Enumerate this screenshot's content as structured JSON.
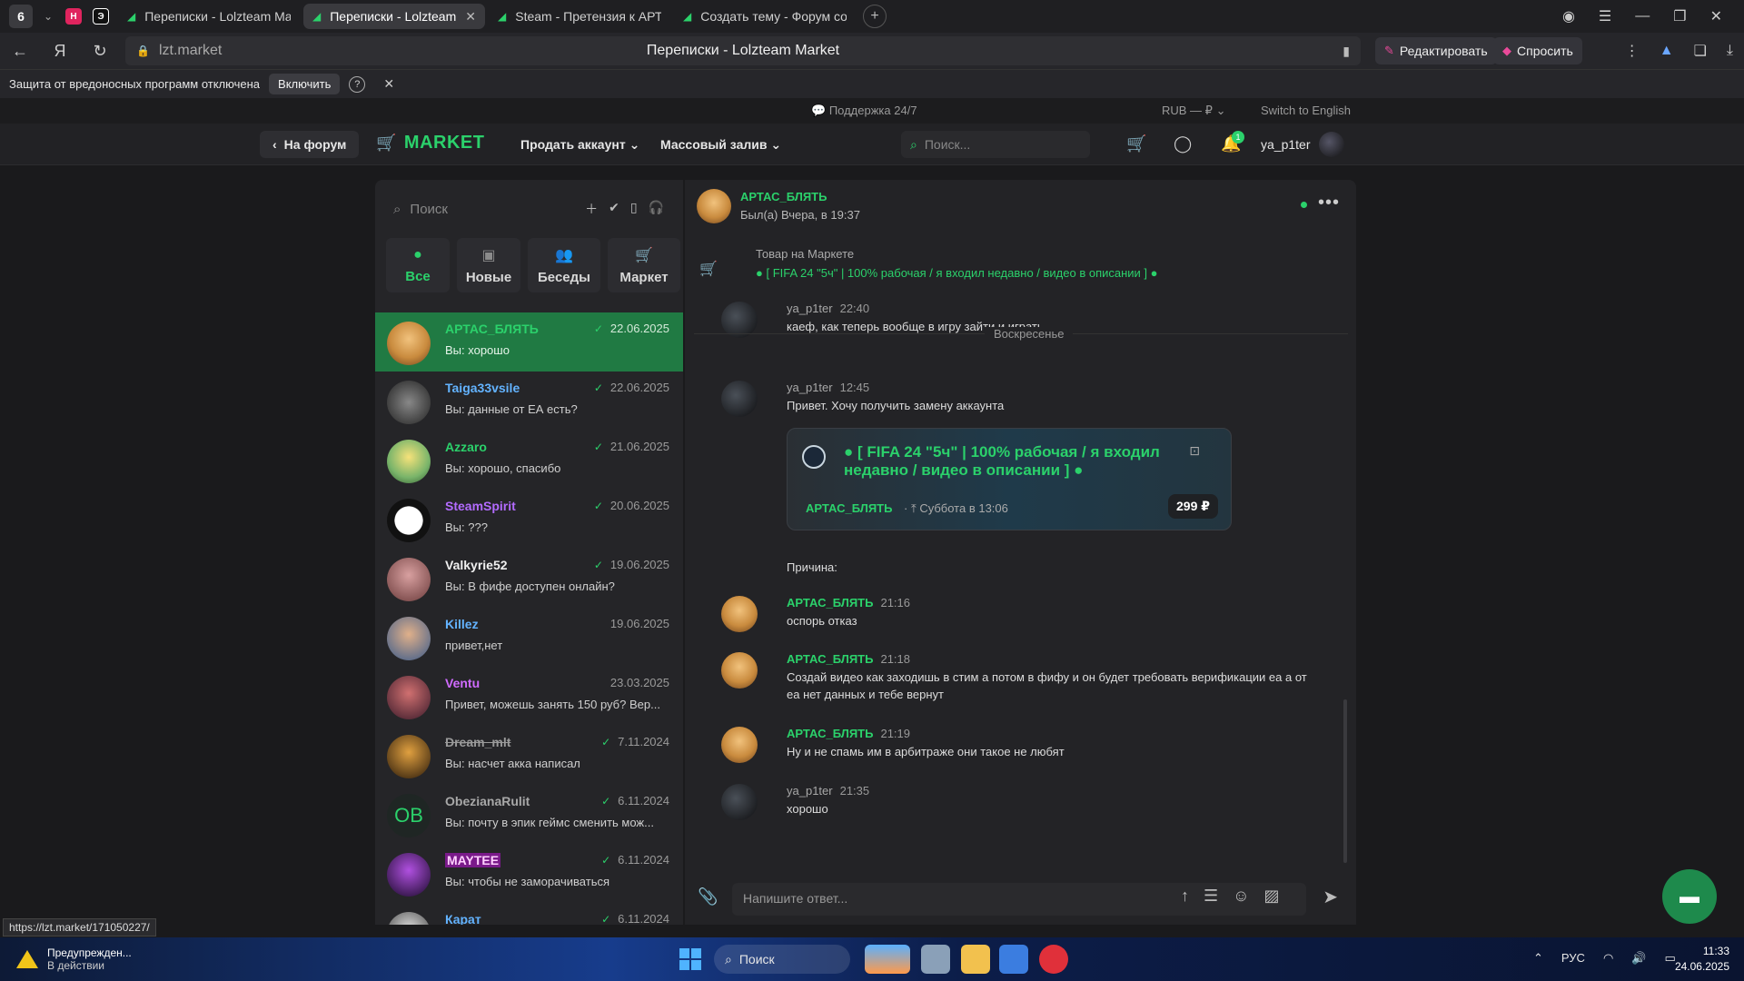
{
  "browser": {
    "tab_count": "6",
    "tabs": [
      {
        "title": "Переписки - Lolzteam Ma",
        "active": false
      },
      {
        "title": "Переписки - Lolzteam M",
        "active": true
      },
      {
        "title": "Steam - Претензия к АРТА",
        "active": false
      },
      {
        "title": "Создать тему - Форум со",
        "active": false
      }
    ],
    "url": "lzt.market",
    "page_title": "Переписки - Lolzteam Market",
    "edit_button": "Редактировать",
    "ask_button": "Спросить"
  },
  "protection_bar": {
    "text": "Защита от вредоносных программ отключена",
    "enable_button": "Включить",
    "help": "?"
  },
  "site_strip": {
    "support": "Поддержка 24/7",
    "currency": "RUB — ₽",
    "language": "Switch to English"
  },
  "header": {
    "to_forum": "На форум",
    "logo": "MARKET",
    "menu": [
      "Продать аккаунт",
      "Массовый залив"
    ],
    "search_placeholder": "Поиск...",
    "notif_count": "1",
    "username": "ya_p1ter"
  },
  "conversations": {
    "search_placeholder": "Поиск",
    "filters": [
      "Все",
      "Новые",
      "Беседы",
      "Маркет"
    ],
    "items": [
      {
        "name": "АРТАС_БЛЯТЬ",
        "date": "22.06.2025",
        "preview": "Вы: хорошо",
        "name_color": "#2bd16b",
        "read": true,
        "active": true
      },
      {
        "name": "Taiga33vsile",
        "date": "22.06.2025",
        "preview": "Вы: данные от ЕА есть?",
        "name_color": "#63b3ff",
        "read": true
      },
      {
        "name": "Azzaro",
        "date": "21.06.2025",
        "preview": "Вы: хорошо, спасибо",
        "name_color": "#2bd16b",
        "read": true
      },
      {
        "name": "SteamSpirit",
        "date": "20.06.2025",
        "preview": "Вы: ???",
        "name_color": "#b36bff",
        "read": true
      },
      {
        "name": "Valkyrie52",
        "date": "19.06.2025",
        "preview": "Вы: В фифе доступен онлайн?",
        "name_color": "#f0f0f0",
        "read": true
      },
      {
        "name": "Killez",
        "date": "19.06.2025",
        "preview": "привет,нет",
        "name_color": "#63b3ff",
        "read": false
      },
      {
        "name": "Ventu",
        "date": "23.03.2025",
        "preview": "Привет, можешь занять 150 руб? Вер...",
        "name_color": "#d06bff",
        "read": false
      },
      {
        "name": "Dream_mlt",
        "date": "7.11.2024",
        "preview": "Вы: насчет акка написал",
        "name_color": "#9a9a9a",
        "read": true,
        "strike": true
      },
      {
        "name": "ObezianaRulit",
        "date": "6.11.2024",
        "preview": "Вы: почту в эпик геймс сменить мож...",
        "name_color": "#a8a8a8",
        "read": true,
        "initials": "OB"
      },
      {
        "name": "MAYTEE",
        "date": "6.11.2024",
        "preview": "Вы: чтобы не заморачиваться",
        "name_color": "#ff5cf0",
        "read": true,
        "highlight": true
      },
      {
        "name": "Карат",
        "date": "6.11.2024",
        "preview": "",
        "name_color": "#63b3ff",
        "read": true
      }
    ]
  },
  "chat": {
    "partner": "АРТАС_БЛЯТЬ",
    "last_seen": "Был(а) Вчера, в 19:37",
    "market_label": "Товар на Маркете",
    "market_link": "● [ FIFA 24 \"5ч\" | 100% рабочая / я входил недавно / видео в описании ] ●",
    "day_separator": "Воскресенье",
    "reason_label": "Причина:",
    "card": {
      "title": "● [ FIFA 24 \"5ч\" | 100% рабочая / я входил недавно / видео в описании ] ●",
      "seller": "АРТАС_БЛЯТЬ",
      "when": "Суббота в 13:06",
      "price": "299 ₽"
    },
    "messages": [
      {
        "author": "ya_p1ter",
        "time": "22:40",
        "text": "каеф, как теперь вообще в игру зайти и играть",
        "self": true
      },
      {
        "author": "ya_p1ter",
        "time": "12:45",
        "text": "Привет. Хочу получить замену аккаунта",
        "self": true
      },
      {
        "author": "АРТАС_БЛЯТЬ",
        "time": "21:16",
        "text": "оспорь отказ",
        "self": false
      },
      {
        "author": "АРТАС_БЛЯТЬ",
        "time": "21:18",
        "text": "Создай видео как заходишь в стим а потом в фифу и он будет требовать верификации еа а от еа нет данных и тебе вернут",
        "self": false
      },
      {
        "author": "АРТАС_БЛЯТЬ",
        "time": "21:19",
        "text": "Ну и не спамь им в арбитраже они такое не любят",
        "self": false
      },
      {
        "author": "ya_p1ter",
        "time": "21:35",
        "text": "хорошо",
        "self": true
      }
    ],
    "composer_placeholder": "Напишите ответ..."
  },
  "status_url": "https://lzt.market/171050227/",
  "taskbar": {
    "warning_title": "Предупрежден...",
    "warning_sub": "В действии",
    "search": "Поиск",
    "language": "РУС",
    "time": "11:33",
    "date": "24.06.2025"
  },
  "colors": {
    "accent": "#2bd16b",
    "active_conv": "#207a43",
    "panel": "#252528"
  }
}
